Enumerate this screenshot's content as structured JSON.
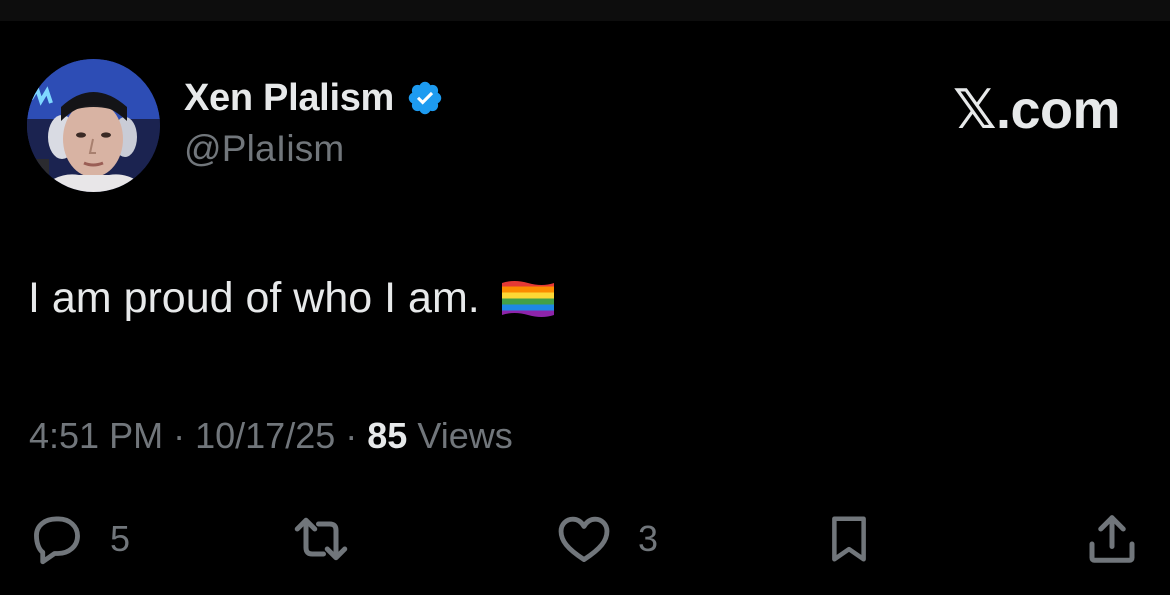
{
  "author": {
    "display_name": "Xen Plalism",
    "handle": "@PlaIism",
    "verified_icon": "verified-badge-icon",
    "badge_color": "#1d9bf0"
  },
  "brand": {
    "label": "𝕏.com"
  },
  "tweet": {
    "text": "I am proud of who I am.",
    "emoji_icon": "rainbow-flag-icon"
  },
  "meta": {
    "time": "4:51 PM",
    "separator": "·",
    "date": "10/17/25",
    "views_count": "85",
    "views_label": "Views"
  },
  "actions": {
    "reply": {
      "icon": "reply-icon",
      "count": "5"
    },
    "repost": {
      "icon": "repost-icon",
      "count": ""
    },
    "like": {
      "icon": "heart-icon",
      "count": "3"
    },
    "bookmark": {
      "icon": "bookmark-icon"
    },
    "share": {
      "icon": "share-icon"
    }
  },
  "colors": {
    "background": "#000000",
    "primary_text": "#e7e9ea",
    "secondary_text": "#71767b",
    "accent": "#1d9bf0"
  }
}
